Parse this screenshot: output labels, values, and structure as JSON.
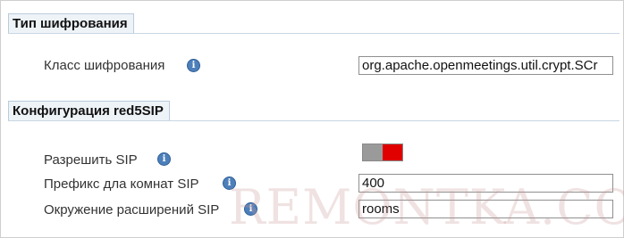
{
  "encryption_section": {
    "title": "Тип шифрования",
    "crypt_class": {
      "label": "Класс шифрования",
      "value": "org.apache.openmeetings.util.crypt.SCr"
    }
  },
  "sip_section": {
    "title": "Конфигурация red5SIP",
    "enable_sip": {
      "label": "Разрешить SIP",
      "state": "on"
    },
    "room_prefix": {
      "label": "Префикс дла комнат SIP",
      "value": "400"
    },
    "exten_context": {
      "label": "Окружение расширений SIP",
      "value": "rooms"
    }
  },
  "icons": {
    "info": "i"
  },
  "colors": {
    "toggle_on": "#e00000",
    "toggle_off": "#9a9a9a",
    "info_icon": "#4d7fba"
  },
  "watermark": "REMONTKA.COM"
}
